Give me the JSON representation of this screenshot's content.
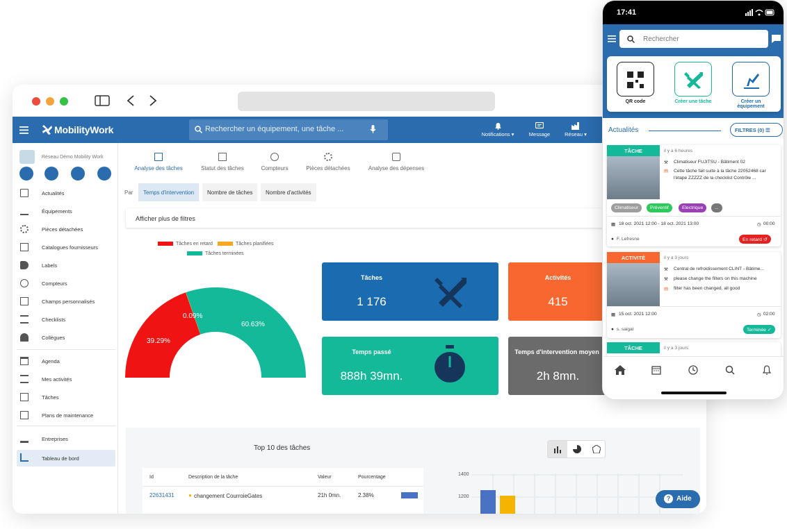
{
  "app": {
    "brand": "MobilityWork"
  },
  "search": {
    "placeholder": "Rechercher un équipement, une tâche ..."
  },
  "topnav": {
    "notifications": "Notifications",
    "message": "Message",
    "reseau": "Réseau"
  },
  "sidebar": {
    "org": "Réseau Démo Mobility Work",
    "items": [
      "Actualités",
      "Équipements",
      "Pièces détachées",
      "Catalogues fournisseurs",
      "Labels",
      "Compteurs",
      "Champs personnalisés",
      "Checklists",
      "Collègues",
      "Agenda",
      "Mes activités",
      "Tâches",
      "Plans de maintenance",
      "Entreprises",
      "Tableau de bord"
    ]
  },
  "tabs": [
    "Analyse des tâches",
    "Statut des tâches",
    "Compteurs",
    "Pièces détachées",
    "Analyse des dépenses"
  ],
  "subtabs": {
    "par": "Par",
    "items": [
      "Temps d'intervention",
      "Nombre de tâches",
      "Nombre d'activités"
    ]
  },
  "filters_label": "Afficher plus de filtres",
  "chart_data": {
    "type": "pie",
    "legend": [
      "Tâches en retard",
      "Tâches planifiées",
      "Tâches terminées"
    ],
    "values": [
      39.29,
      0.09,
      60.63
    ],
    "labels": [
      "39.29%",
      "0.09%",
      "60.63%"
    ],
    "colors": [
      "#ef1313",
      "#f9a720",
      "#14b99a"
    ]
  },
  "cards": [
    {
      "title": "Tâches",
      "value": "1 176",
      "color": "#1b6bb0"
    },
    {
      "title": "Activités",
      "value": "415",
      "color": "#f7672f"
    },
    {
      "title": "Temps passé",
      "value": "888h 39mn.",
      "color": "#14b99a"
    },
    {
      "title": "Temps d'intervention moyen",
      "value": "2h 8mn.",
      "color": "#6b6b6b"
    }
  ],
  "top10": {
    "title": "Top 10 des tâches",
    "headers": [
      "Id",
      "Description de la tâche",
      "Valeur",
      "Pourcentage"
    ],
    "row": {
      "id": "22631431",
      "description": "changement CourroieGates",
      "value": "21h 0mn.",
      "pct": "2.38%"
    },
    "yticks": [
      "1400",
      "1200"
    ]
  },
  "help": "Aide",
  "phone": {
    "time": "17:41",
    "search_placeholder": "Rechercher",
    "actions": [
      "QR code",
      "Créer une tâche",
      "Créer un équipement"
    ],
    "feed_title": "Actualités",
    "filters_btn": "FILTRES (0)",
    "feed": [
      {
        "tag": "TÂCHE",
        "tag_color": "#14b99a",
        "when": "il y a 6 heures",
        "line1": "Climatiseur FUJITSU - Bâtiment 02",
        "line2": "Cette tâche fait suite à la tâche 22052468 car l'étape ZZZZZ de la checklist Contrôle ...",
        "chips": [
          "Climatiseur",
          "Préventif",
          "Electrique",
          "..."
        ],
        "dates": "18 oct. 2021 12:00 - 18 oct. 2021 13:00",
        "duration": "00:00",
        "user": "F. Lefresne",
        "status": "En retard"
      },
      {
        "tag": "ACTIVITÉ",
        "tag_color": "#f7672f",
        "when": "il y a 3 jours",
        "line1": "Central de refroidissement CLINT - Bâtime...",
        "line2": "please change the filters on this machine",
        "line3": "filter has been changed, all good",
        "dates": "15 oct. 2021 12:00",
        "duration": "02:00",
        "user": "s. saigal",
        "status": "Terminée"
      },
      {
        "tag": "TÂCHE",
        "tag_color": "#14b99a",
        "when": "il y a 3 jours"
      }
    ]
  }
}
